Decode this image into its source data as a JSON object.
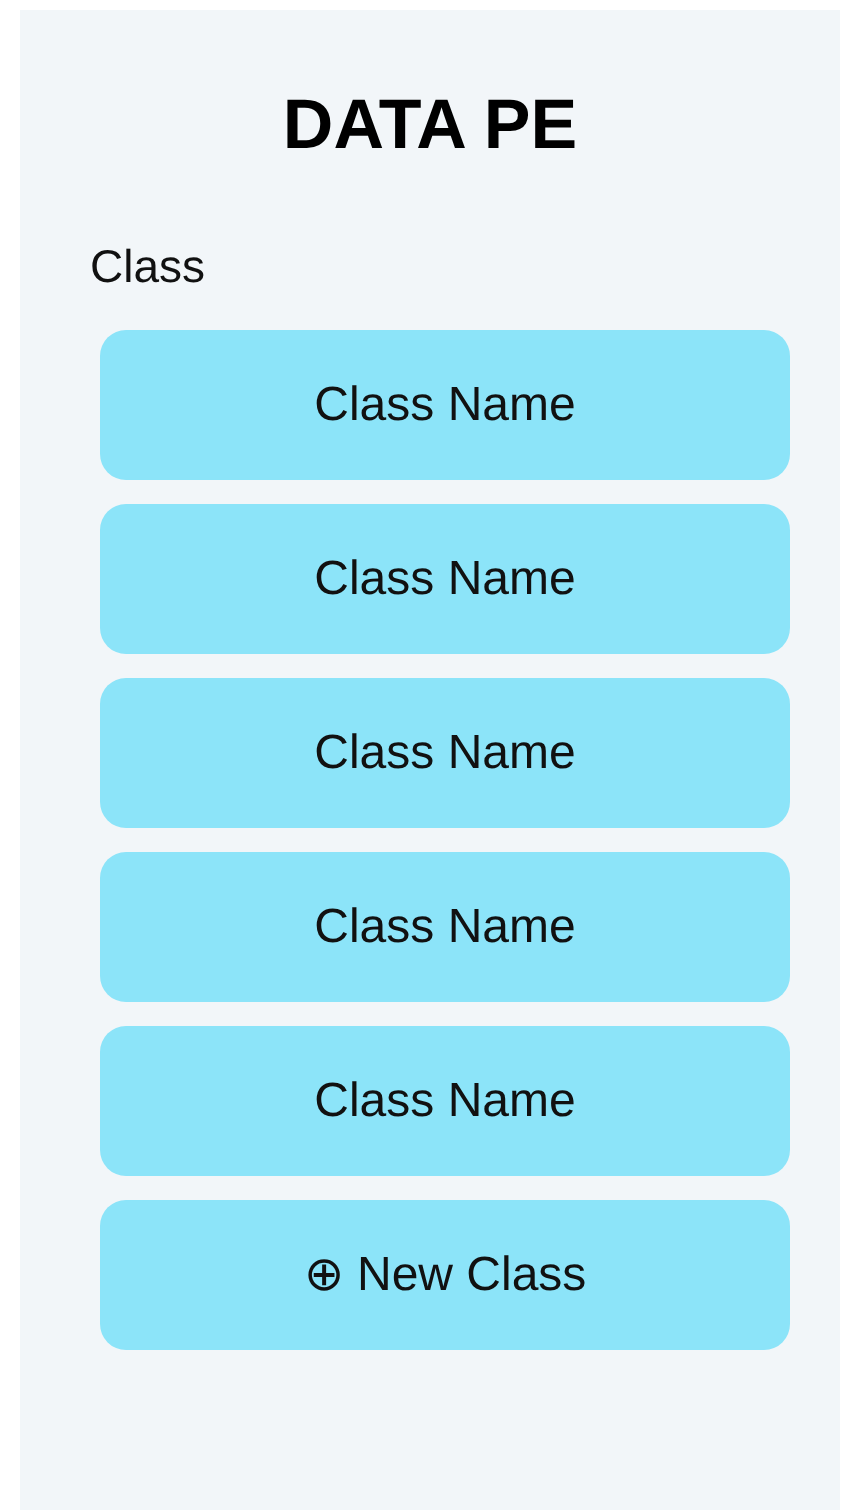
{
  "title": "DATA PE",
  "section_label": "Class",
  "classes": [
    {
      "label": "Class Name"
    },
    {
      "label": "Class Name"
    },
    {
      "label": "Class Name"
    },
    {
      "label": "Class Name"
    },
    {
      "label": "Class Name"
    }
  ],
  "new_class_button": {
    "icon": "⊕",
    "label": "New Class"
  }
}
